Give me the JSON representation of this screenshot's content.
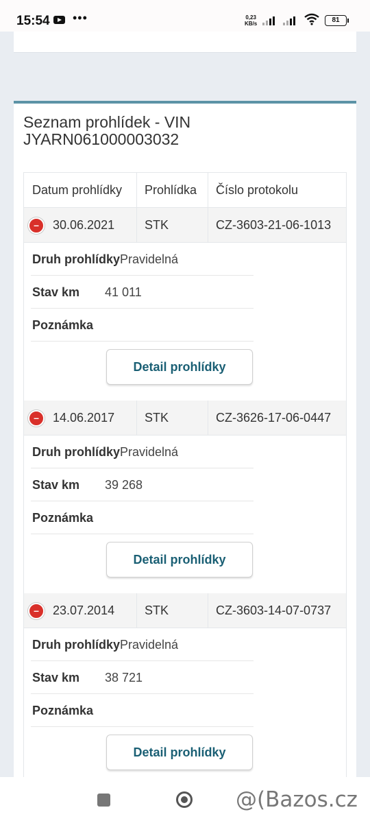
{
  "status_bar": {
    "time": "15:54",
    "speed_value": "0,23",
    "speed_unit": "KB/s",
    "battery": "81",
    "icons": [
      "youtube-icon",
      "signal-icon",
      "wifi-icon",
      "battery-icon"
    ]
  },
  "card": {
    "title_line1": "Seznam prohlídek - VIN",
    "title_line2": "JYARN061000003032"
  },
  "table": {
    "headers": [
      "Datum prohlídky",
      "Prohlídka",
      "Číslo protokolu"
    ],
    "inspections": [
      {
        "date": "30.06.2021",
        "type": "STK",
        "protocol": "CZ-3603-21-06-1013",
        "druh_label": "Druh prohlídky",
        "druh_value": "Pravidelná",
        "km_label": "Stav km",
        "km_value": "41 011",
        "note_label": "Poznámka",
        "note_value": "",
        "button": "Detail prohlídky"
      },
      {
        "date": "14.06.2017",
        "type": "STK",
        "protocol": "CZ-3626-17-06-0447",
        "druh_label": "Druh prohlídky",
        "druh_value": "Pravidelná",
        "km_label": "Stav km",
        "km_value": "39 268",
        "note_label": "Poznámka",
        "note_value": "",
        "button": "Detail prohlídky"
      },
      {
        "date": "23.07.2014",
        "type": "STK",
        "protocol": "CZ-3603-14-07-0737",
        "druh_label": "Druh prohlídky",
        "druh_value": "Pravidelná",
        "km_label": "Stav km",
        "km_value": "38 721",
        "note_label": "Poznámka",
        "note_value": "",
        "button": "Detail prohlídky"
      }
    ]
  },
  "watermark": "@(Bazos.cz",
  "colors": {
    "accent": "#5c93a6",
    "collapse_icon": "#d9302a",
    "button_text": "#1a5f74",
    "page_bg": "#e9edf2"
  }
}
